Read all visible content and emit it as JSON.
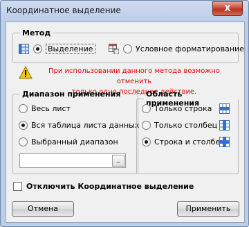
{
  "window": {
    "title": "Координатное выделение",
    "close_label": "X"
  },
  "method": {
    "legend": "Метод",
    "option_selection": "Выделение",
    "option_conditional": "Условное форматирование",
    "selected": "Выделение"
  },
  "warning": {
    "line1": "При использовании данного метода возможно отменить",
    "line2": "только одно последнее действие."
  },
  "range": {
    "legend": "Диапазон применения",
    "option_whole_sheet": "Весь лист",
    "option_whole_table": "Вся таблица листа данных",
    "option_selected_range": "Выбранный диапазон",
    "selected": "Вся таблица листа данных",
    "input_value": "",
    "input_button": "_"
  },
  "area": {
    "legend": "Область применения",
    "option_row": "Только строка",
    "option_column": "Только столбец",
    "option_both": "Строка и столбец",
    "selected": "Строка и столбец"
  },
  "disable": {
    "label": "Отключить Координатное выделение",
    "checked": false
  },
  "buttons": {
    "cancel": "Отмена",
    "apply": "Применить"
  },
  "colors": {
    "warning_text": "#e00000",
    "grid_blue": "#2f6fd6"
  }
}
